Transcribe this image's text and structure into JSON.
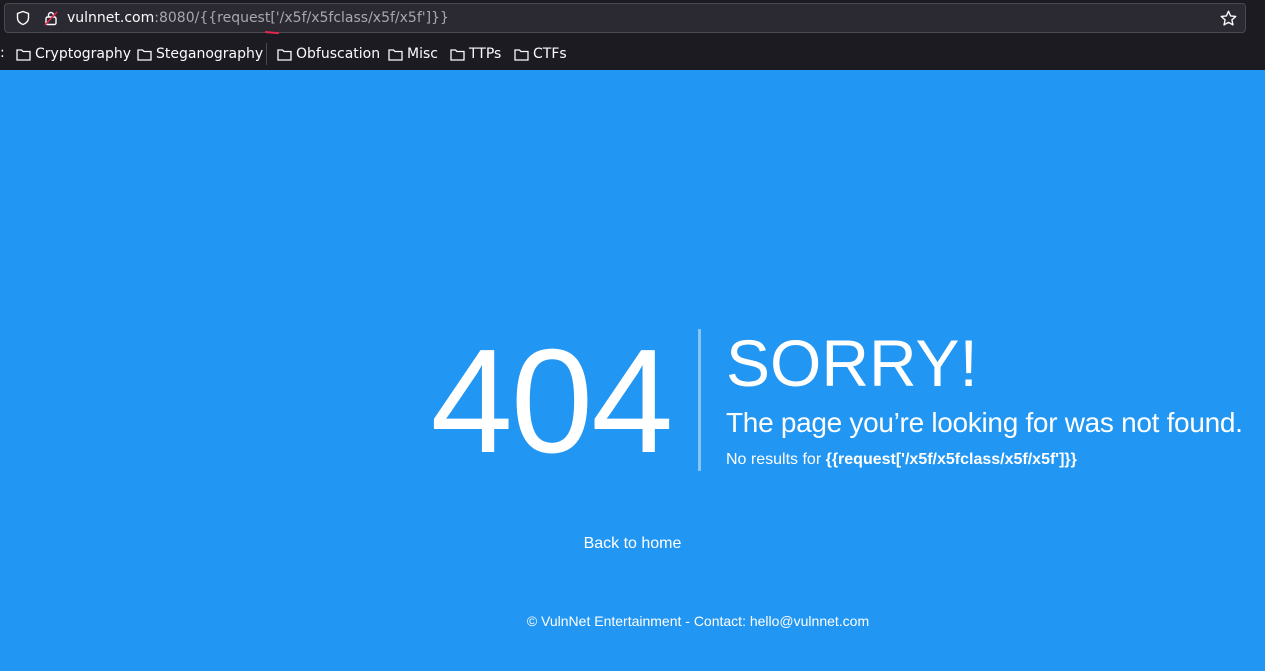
{
  "browser": {
    "url_host": "vulnnet.com",
    "url_rest": ":8080/{{request['/x5f/x5fclass/x5f/x5f']}}",
    "bookmarks": [
      "Cryptography",
      "Steganography",
      "Obfuscation",
      "Misc",
      "TTPs",
      "CTFs"
    ]
  },
  "page": {
    "code": "404",
    "headline": "SORRY!",
    "message": "The page you’re looking for was not found.",
    "no_results_prefix": "No results for ",
    "no_results_query": "{{request['/x5f/x5fclass/x5f/x5f']}}",
    "back_link": "Back to home",
    "footer": "© VulnNet Entertainment - Contact: hello@vulnnet.com"
  },
  "colors": {
    "page_background": "#2196f3",
    "chrome_background": "#1c1b22"
  }
}
